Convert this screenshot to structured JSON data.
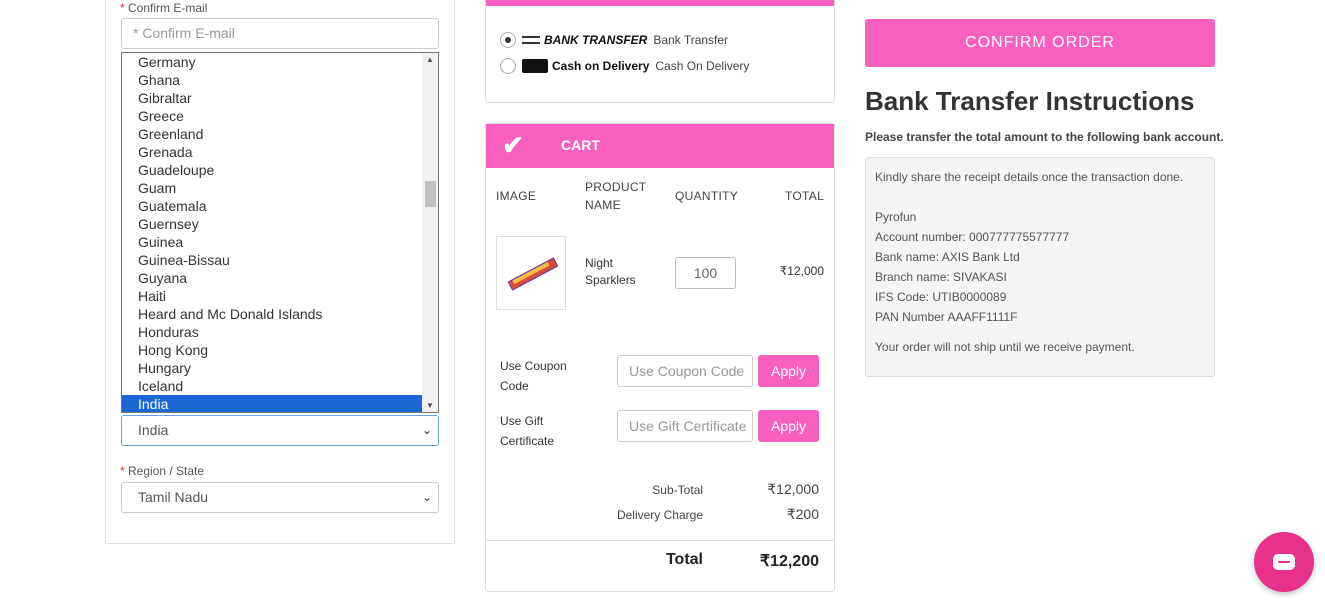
{
  "form": {
    "confirm_email_label": "Confirm E-mail",
    "required_mark": "*",
    "confirm_email_placeholder": "* Confirm E-mail",
    "country_options": [
      "Germany",
      "Ghana",
      "Gibraltar",
      "Greece",
      "Greenland",
      "Grenada",
      "Guadeloupe",
      "Guam",
      "Guatemala",
      "Guernsey",
      "Guinea",
      "Guinea-Bissau",
      "Guyana",
      "Haiti",
      "Heard and Mc Donald Islands",
      "Honduras",
      "Hong Kong",
      "Hungary",
      "Iceland",
      "India"
    ],
    "country_selected": "India",
    "region_label": "Region / State",
    "region_selected": "Tamil Nadu"
  },
  "payment": {
    "options": [
      {
        "logo": "BANK TRANSFER",
        "label": "Bank Transfer",
        "selected": true
      },
      {
        "logo": "Cash on Delivery",
        "label": "Cash On Delivery",
        "selected": false
      }
    ]
  },
  "cart": {
    "title": "CART",
    "headers": {
      "image": "IMAGE",
      "product": "PRODUCT NAME",
      "quantity": "QUANTITY",
      "total": "TOTAL"
    },
    "items": [
      {
        "name": "Night Sparklers",
        "quantity": "100",
        "total": "₹12,000"
      }
    ],
    "coupon_label": "Use Coupon Code",
    "coupon_placeholder": "Use Coupon Code",
    "gift_label": "Use Gift Certificate",
    "gift_placeholder": "Use Gift Certificate",
    "apply_label": "Apply",
    "subtotal_label": "Sub-Total",
    "subtotal_value": "₹12,000",
    "delivery_label": "Delivery Charge",
    "delivery_value": "₹200",
    "total_label": "Total",
    "total_value": "₹12,200"
  },
  "confirm_button": "CONFIRM ORDER",
  "bank_transfer": {
    "title": "Bank Transfer Instructions",
    "subtitle": "Please transfer the total amount to the following bank account.",
    "lines": [
      "Kindly share the receipt details once the transaction done.",
      "Pyrofun",
      "Account number: 000777775577777",
      "Bank name: AXIS Bank Ltd",
      "Branch name: SIVAKASI",
      "IFS Code: UTIB0000089",
      "PAN Number AAAFF1111F",
      "Your order will not ship until we receive payment."
    ]
  },
  "colors": {
    "accent": "#f85fbf",
    "selected_option": "#1a66d2",
    "chat": "#e8318a"
  }
}
